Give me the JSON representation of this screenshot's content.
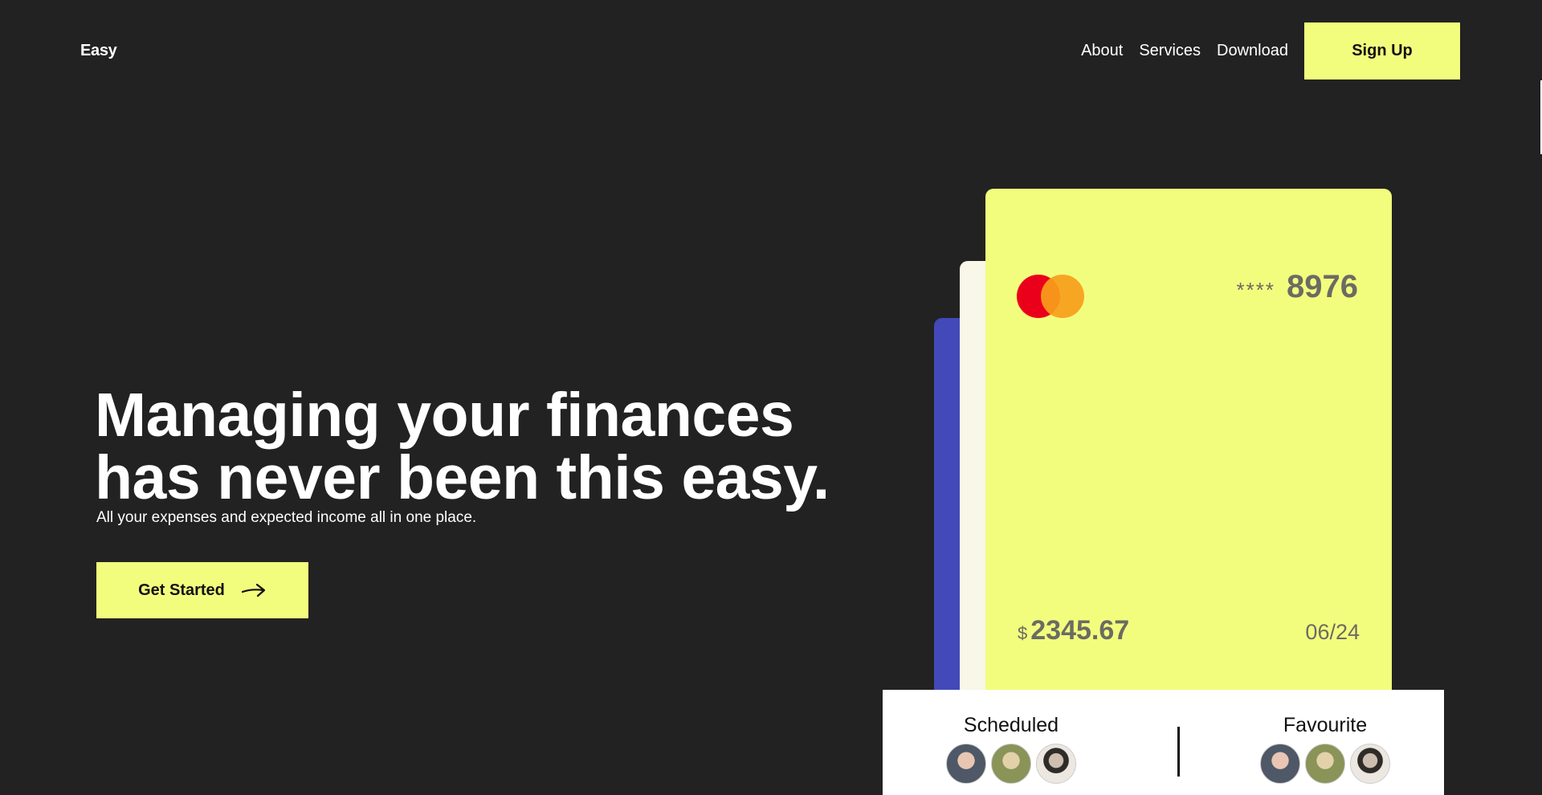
{
  "header": {
    "logo": "Easy",
    "nav": [
      "About",
      "Services",
      "Download"
    ],
    "signup_label": "Sign Up"
  },
  "hero": {
    "title_line1": "Managing your finances",
    "title_line2": "has never been this easy.",
    "subtitle": "All your expenses and expected income all in one place.",
    "cta_label": "Get Started"
  },
  "card": {
    "number_mask": "****",
    "last4": "8976",
    "currency": "$",
    "balance": "2345.67",
    "expiry": "06/24"
  },
  "panel": {
    "scheduled_title": "Scheduled",
    "favourite_title": "Favourite"
  },
  "colors": {
    "background": "#222222",
    "accent": "#f3fd7d",
    "card_blue": "#4349b8",
    "card_cream": "#f8f7e8"
  },
  "icons": [
    "arrow-right-icon",
    "mastercard-logo"
  ]
}
